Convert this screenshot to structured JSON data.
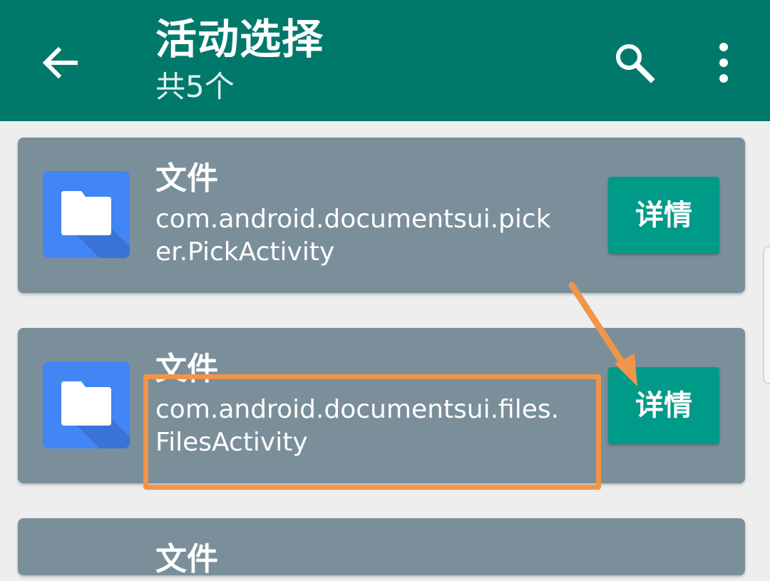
{
  "header": {
    "title": "活动选择",
    "subtitle": "共5个"
  },
  "items": [
    {
      "name": "文件",
      "package": "com.android.documentsui.pick\ner.PickActivity",
      "button": "详情"
    },
    {
      "name": "文件",
      "package": "com.android.documentsui.files.\nFilesActivity",
      "button": "详情"
    },
    {
      "name": "文件"
    }
  ],
  "icons": {
    "back": "arrow-back-icon",
    "search": "search-icon",
    "overflow": "more-vert-icon",
    "app": "folder-icon"
  },
  "colors": {
    "appbar": "#00796b",
    "card": "#7a8f99",
    "button": "#009b88",
    "app_icon": "#4285f4",
    "annotation": "#f0954a"
  }
}
